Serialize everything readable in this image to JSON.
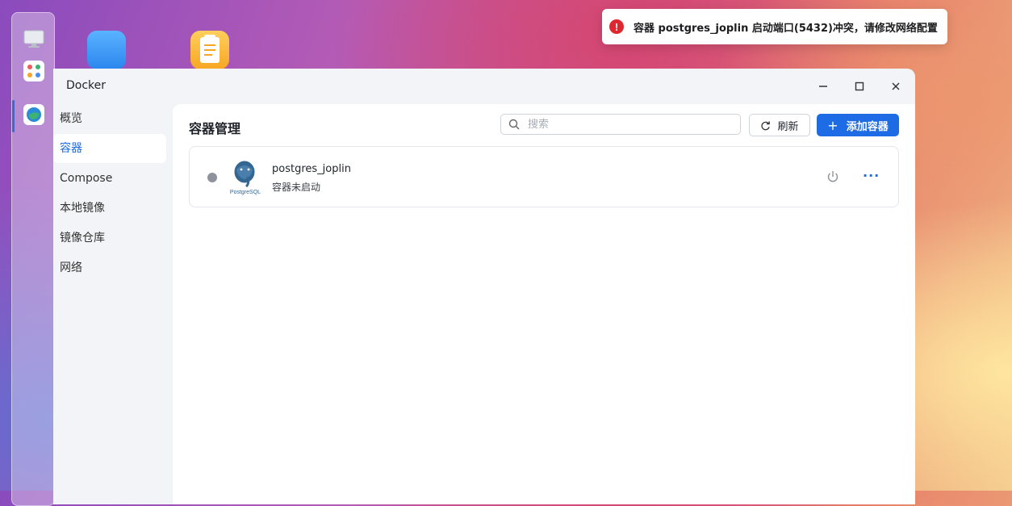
{
  "toast": {
    "message": "容器 postgres_joplin 启动端口(5432)冲突，请修改网络配置",
    "icon": "error-icon",
    "icon_glyph": "!",
    "color": "#e0262f"
  },
  "window": {
    "title": "Docker",
    "controls": {
      "minimize": "—",
      "maximize": "☐",
      "close": "✕"
    }
  },
  "sidebar": {
    "items": [
      {
        "label": "概览"
      },
      {
        "label": "容器"
      },
      {
        "label": "Compose"
      },
      {
        "label": "本地镜像"
      },
      {
        "label": "镜像仓库"
      },
      {
        "label": "网络"
      }
    ],
    "active_index": 1
  },
  "main": {
    "title": "容器管理",
    "search": {
      "placeholder": "搜索",
      "value": ""
    },
    "refresh_label": "刷新",
    "add_label": "添加容器",
    "add_glyph": "+"
  },
  "containers": [
    {
      "name": "postgres_joplin",
      "status": "容器未启动",
      "logo_text": "PostgreSQL",
      "more_glyph": "···"
    }
  ],
  "colors": {
    "accent": "#1e6be6",
    "status_stopped": "#8e939b",
    "error": "#e0262f"
  }
}
